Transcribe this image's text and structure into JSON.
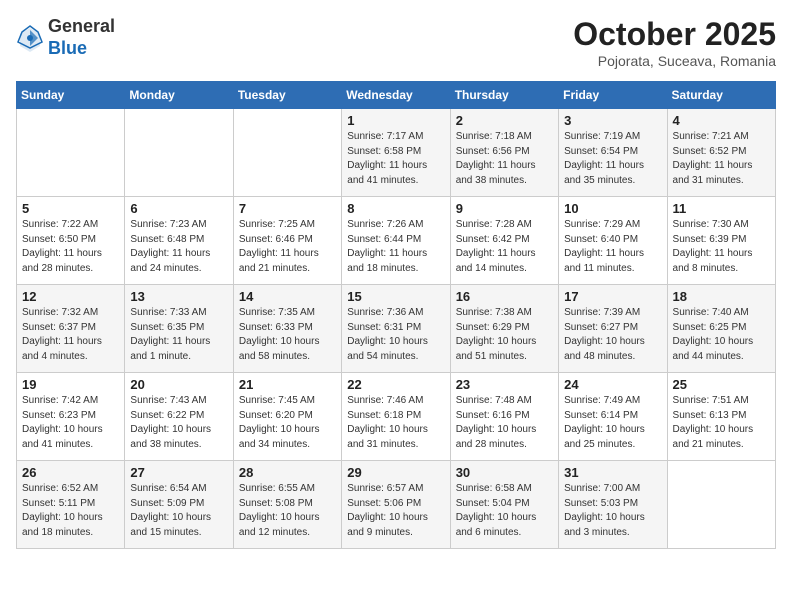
{
  "header": {
    "logo_general": "General",
    "logo_blue": "Blue",
    "month_title": "October 2025",
    "subtitle": "Pojorata, Suceava, Romania"
  },
  "weekdays": [
    "Sunday",
    "Monday",
    "Tuesday",
    "Wednesday",
    "Thursday",
    "Friday",
    "Saturday"
  ],
  "weeks": [
    [
      {
        "day": "",
        "info": ""
      },
      {
        "day": "",
        "info": ""
      },
      {
        "day": "",
        "info": ""
      },
      {
        "day": "1",
        "info": "Sunrise: 7:17 AM\nSunset: 6:58 PM\nDaylight: 11 hours\nand 41 minutes."
      },
      {
        "day": "2",
        "info": "Sunrise: 7:18 AM\nSunset: 6:56 PM\nDaylight: 11 hours\nand 38 minutes."
      },
      {
        "day": "3",
        "info": "Sunrise: 7:19 AM\nSunset: 6:54 PM\nDaylight: 11 hours\nand 35 minutes."
      },
      {
        "day": "4",
        "info": "Sunrise: 7:21 AM\nSunset: 6:52 PM\nDaylight: 11 hours\nand 31 minutes."
      }
    ],
    [
      {
        "day": "5",
        "info": "Sunrise: 7:22 AM\nSunset: 6:50 PM\nDaylight: 11 hours\nand 28 minutes."
      },
      {
        "day": "6",
        "info": "Sunrise: 7:23 AM\nSunset: 6:48 PM\nDaylight: 11 hours\nand 24 minutes."
      },
      {
        "day": "7",
        "info": "Sunrise: 7:25 AM\nSunset: 6:46 PM\nDaylight: 11 hours\nand 21 minutes."
      },
      {
        "day": "8",
        "info": "Sunrise: 7:26 AM\nSunset: 6:44 PM\nDaylight: 11 hours\nand 18 minutes."
      },
      {
        "day": "9",
        "info": "Sunrise: 7:28 AM\nSunset: 6:42 PM\nDaylight: 11 hours\nand 14 minutes."
      },
      {
        "day": "10",
        "info": "Sunrise: 7:29 AM\nSunset: 6:40 PM\nDaylight: 11 hours\nand 11 minutes."
      },
      {
        "day": "11",
        "info": "Sunrise: 7:30 AM\nSunset: 6:39 PM\nDaylight: 11 hours\nand 8 minutes."
      }
    ],
    [
      {
        "day": "12",
        "info": "Sunrise: 7:32 AM\nSunset: 6:37 PM\nDaylight: 11 hours\nand 4 minutes."
      },
      {
        "day": "13",
        "info": "Sunrise: 7:33 AM\nSunset: 6:35 PM\nDaylight: 11 hours\nand 1 minute."
      },
      {
        "day": "14",
        "info": "Sunrise: 7:35 AM\nSunset: 6:33 PM\nDaylight: 10 hours\nand 58 minutes."
      },
      {
        "day": "15",
        "info": "Sunrise: 7:36 AM\nSunset: 6:31 PM\nDaylight: 10 hours\nand 54 minutes."
      },
      {
        "day": "16",
        "info": "Sunrise: 7:38 AM\nSunset: 6:29 PM\nDaylight: 10 hours\nand 51 minutes."
      },
      {
        "day": "17",
        "info": "Sunrise: 7:39 AM\nSunset: 6:27 PM\nDaylight: 10 hours\nand 48 minutes."
      },
      {
        "day": "18",
        "info": "Sunrise: 7:40 AM\nSunset: 6:25 PM\nDaylight: 10 hours\nand 44 minutes."
      }
    ],
    [
      {
        "day": "19",
        "info": "Sunrise: 7:42 AM\nSunset: 6:23 PM\nDaylight: 10 hours\nand 41 minutes."
      },
      {
        "day": "20",
        "info": "Sunrise: 7:43 AM\nSunset: 6:22 PM\nDaylight: 10 hours\nand 38 minutes."
      },
      {
        "day": "21",
        "info": "Sunrise: 7:45 AM\nSunset: 6:20 PM\nDaylight: 10 hours\nand 34 minutes."
      },
      {
        "day": "22",
        "info": "Sunrise: 7:46 AM\nSunset: 6:18 PM\nDaylight: 10 hours\nand 31 minutes."
      },
      {
        "day": "23",
        "info": "Sunrise: 7:48 AM\nSunset: 6:16 PM\nDaylight: 10 hours\nand 28 minutes."
      },
      {
        "day": "24",
        "info": "Sunrise: 7:49 AM\nSunset: 6:14 PM\nDaylight: 10 hours\nand 25 minutes."
      },
      {
        "day": "25",
        "info": "Sunrise: 7:51 AM\nSunset: 6:13 PM\nDaylight: 10 hours\nand 21 minutes."
      }
    ],
    [
      {
        "day": "26",
        "info": "Sunrise: 6:52 AM\nSunset: 5:11 PM\nDaylight: 10 hours\nand 18 minutes."
      },
      {
        "day": "27",
        "info": "Sunrise: 6:54 AM\nSunset: 5:09 PM\nDaylight: 10 hours\nand 15 minutes."
      },
      {
        "day": "28",
        "info": "Sunrise: 6:55 AM\nSunset: 5:08 PM\nDaylight: 10 hours\nand 12 minutes."
      },
      {
        "day": "29",
        "info": "Sunrise: 6:57 AM\nSunset: 5:06 PM\nDaylight: 10 hours\nand 9 minutes."
      },
      {
        "day": "30",
        "info": "Sunrise: 6:58 AM\nSunset: 5:04 PM\nDaylight: 10 hours\nand 6 minutes."
      },
      {
        "day": "31",
        "info": "Sunrise: 7:00 AM\nSunset: 5:03 PM\nDaylight: 10 hours\nand 3 minutes."
      },
      {
        "day": "",
        "info": ""
      }
    ]
  ]
}
